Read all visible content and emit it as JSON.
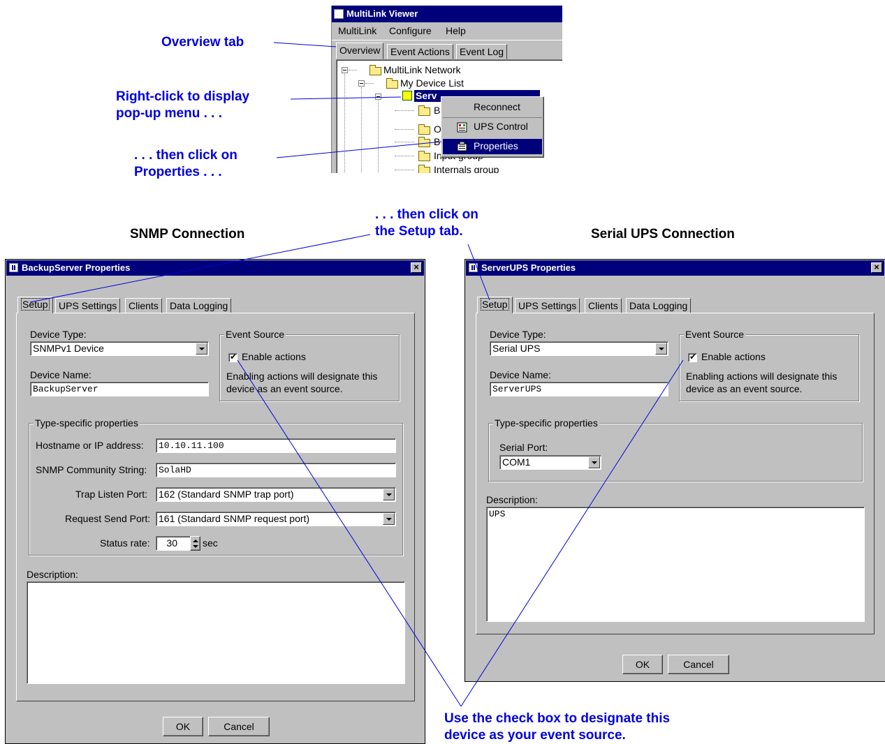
{
  "callouts": {
    "overview_tab": "Overview tab",
    "right_click_line1": "Right-click to display",
    "right_click_line2": "pop-up menu . . .",
    "click_properties_line1": ". . . then click on",
    "click_properties_line2": "Properties . . .",
    "setup_tab_line1": ". . . then click on",
    "setup_tab_line2": "the Setup tab.",
    "checkbox_line1": "Use the check box to designate this",
    "checkbox_line2": "device as your event source."
  },
  "headings": {
    "snmp": "SNMP Connection",
    "serial": "Serial UPS Connection"
  },
  "viewer": {
    "title": "MultiLink Viewer",
    "menus": [
      "MultiLink",
      "Configure",
      "Help"
    ],
    "tabs": [
      "Overview",
      "Event Actions",
      "Event Log"
    ],
    "tree": {
      "root": "MultiLink Network",
      "device_list": "My Device List",
      "server": "Serv",
      "children": [
        "B",
        "O",
        "B",
        "Input group",
        "Internals group"
      ]
    },
    "popup": [
      "Reconnect",
      "UPS Control",
      "Properties"
    ]
  },
  "snmp_dialog": {
    "title": "BackupServer Properties",
    "tabs": [
      "Setup",
      "UPS Settings",
      "Clients",
      "Data Logging"
    ],
    "device_type_label": "Device Type:",
    "device_type_value": "SNMPv1 Device",
    "device_name_label": "Device Name:",
    "device_name_value": "BackupServer",
    "event_source_legend": "Event Source",
    "enable_actions_label": "Enable actions",
    "enable_actions_checked": true,
    "event_source_note_1": "Enabling actions will designate this",
    "event_source_note_2": "device as an event source.",
    "type_specific_legend": "Type-specific properties",
    "hostname_label": "Hostname or IP address:",
    "hostname_value": "10.10.11.100",
    "community_label": "SNMP Community String:",
    "community_value": "SolaHD",
    "trap_label": "Trap Listen Port:",
    "trap_value": "162 (Standard SNMP trap port)",
    "request_label": "Request Send Port:",
    "request_value": "161 (Standard SNMP request port)",
    "status_rate_label": "Status rate:",
    "status_rate_value": "30",
    "status_rate_unit": "sec",
    "description_label": "Description:",
    "description_value": "",
    "ok": "OK",
    "cancel": "Cancel"
  },
  "serial_dialog": {
    "title": "ServerUPS Properties",
    "tabs": [
      "Setup",
      "UPS Settings",
      "Clients",
      "Data Logging"
    ],
    "device_type_label": "Device Type:",
    "device_type_value": "Serial UPS",
    "device_name_label": "Device Name:",
    "device_name_value": "ServerUPS",
    "event_source_legend": "Event Source",
    "enable_actions_label": "Enable actions",
    "enable_actions_checked": true,
    "event_source_note_1": "Enabling actions will designate this",
    "event_source_note_2": "device as an event source.",
    "type_specific_legend": "Type-specific properties",
    "serial_port_label": "Serial Port:",
    "serial_port_value": "COM1",
    "description_label": "Description:",
    "description_value": "UPS",
    "ok": "OK",
    "cancel": "Cancel"
  },
  "colors": {
    "titlebar": "#00007b",
    "callout": "#0000e0",
    "window": "#c0c0c0"
  }
}
